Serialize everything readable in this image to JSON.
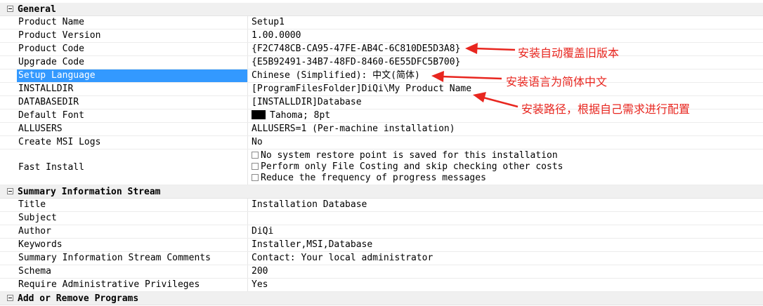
{
  "sections": {
    "general": {
      "title": "General",
      "rows": [
        {
          "name": "Product Name",
          "value": "Setup1"
        },
        {
          "name": "Product Version",
          "value": "1.00.0000"
        },
        {
          "name": "Product Code",
          "value": "{F2C748CB-CA95-47FE-AB4C-6C810DE5D3A8}"
        },
        {
          "name": "Upgrade Code",
          "value": "{E5B92491-34B7-48FD-8460-6E55DFC5B700}"
        },
        {
          "name": "Setup Language",
          "value": "Chinese (Simplified): 中文(简体)"
        },
        {
          "name": "INSTALLDIR",
          "value": "[ProgramFilesFolder]DiQi\\My Product Name"
        },
        {
          "name": "DATABASEDIR",
          "value": "[INSTALLDIR]Database"
        },
        {
          "name": "Default Font",
          "value": "Tahoma; 8pt"
        },
        {
          "name": "ALLUSERS",
          "value": "ALLUSERS=1 (Per-machine installation)"
        },
        {
          "name": "Create MSI Logs",
          "value": "No"
        },
        {
          "name": "Fast Install",
          "options": [
            "No system restore point is saved for this installation",
            "Perform only File Costing and skip checking other costs",
            "Reduce the frequency of progress messages"
          ]
        }
      ]
    },
    "summary": {
      "title": "Summary Information Stream",
      "rows": [
        {
          "name": "Title",
          "value": "Installation Database"
        },
        {
          "name": "Subject",
          "value": ""
        },
        {
          "name": "Author",
          "value": "DiQi"
        },
        {
          "name": "Keywords",
          "value": "Installer,MSI,Database"
        },
        {
          "name": "Summary Information Stream Comments",
          "value": "Contact:  Your local administrator"
        },
        {
          "name": "Schema",
          "value": "200"
        },
        {
          "name": "Require Administrative Privileges",
          "value": "Yes"
        }
      ]
    },
    "add_remove": {
      "title": "Add or Remove Programs"
    }
  },
  "annotations": {
    "product_code": "安装自动覆盖旧版本",
    "setup_language": "安装语言为简体中文",
    "installdir": "安装路径，根据自己需求进行配置"
  },
  "colors": {
    "selection": "#3399ff",
    "annotation": "#e8261f",
    "section_bg": "#f0f0f0"
  }
}
